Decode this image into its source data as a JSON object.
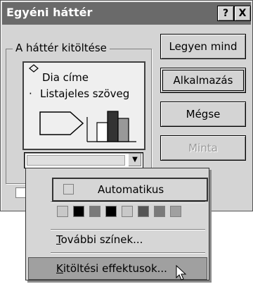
{
  "window": {
    "title": "Egyéni háttér",
    "help_btn": "?",
    "close_btn": "X"
  },
  "group": {
    "label": "A háttér kitöltése"
  },
  "preview": {
    "title_text": "Dia címe",
    "bullet": "·",
    "bullet_text": "Listajeles szöveg"
  },
  "buttons": {
    "apply_all": "Legyen mind",
    "apply": "Alkalmazás",
    "cancel": "Mégse",
    "preview": "Minta"
  },
  "colors": {
    "swatches": [
      "#c8c8c8",
      "#000000",
      "#7a7a7a",
      "#000000",
      "#c8c8c8",
      "#555555",
      "#7a7a7a",
      "#a0a0a0"
    ]
  },
  "popup": {
    "automatic": "Automatikus",
    "more_colors_underline": "T",
    "more_colors_rest": "ovábbi színek...",
    "fill_effects_underline": "K",
    "fill_effects_rest": "itöltési effektusok..."
  }
}
